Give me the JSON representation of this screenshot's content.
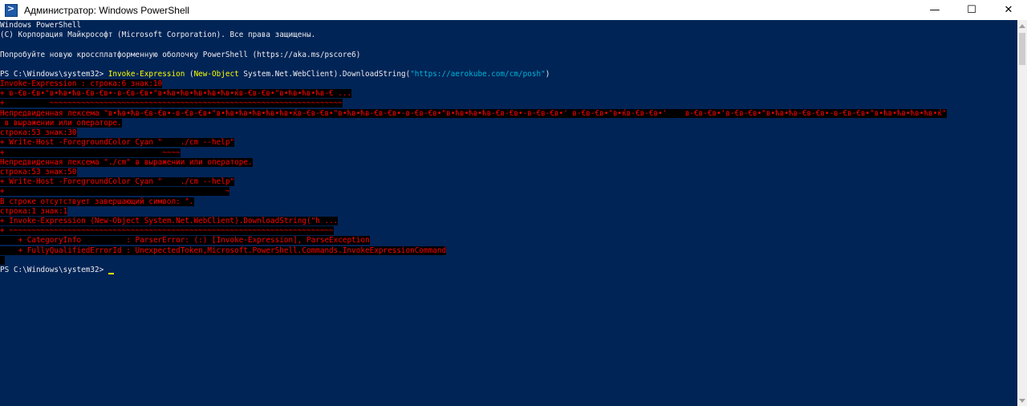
{
  "window": {
    "title": "Администратор: Windows PowerShell",
    "controls": {
      "minimize": "—",
      "maximize": "☐",
      "close": "✕"
    }
  },
  "console": {
    "header": [
      "Windows PowerShell",
      "(C) Корпорация Майкрософт (Microsoft Corporation). Все права защищены.",
      "",
      "Попробуйте новую кроссплатформенную оболочку PowerShell (https://aka.ms/pscore6)"
    ],
    "command": {
      "prompt": "PS C:\\Windows\\system32> ",
      "cmdlet": "Invoke-Expression",
      "space1": " ",
      "paren_open": "(",
      "new_object": "New-Object",
      "type": " System.Net.WebClient).DownloadString(",
      "url": "\"https://aerokube.com/cm/posh\"",
      "close": ")"
    },
    "errors": [
      "Invoke-Expression : строка:6 знак:10",
      "+ в-€в-€в•\"в•ћв•ћв-€в-€в•-в-€в-€в•\"в•ћв•ћв•ћв•ћв•ћв•ќв-€в-€в•\"в•ћв•ћв•ћв-€ ...",
      "+          ~~~~~~~~~~~~~~~~~~~~~~~~~~~~~~~~~~~~~~~~~~~~~~~~~~~~~~~~~~~~~~~~~",
      "Непредвиденная лексема \"в•ћв•ћв-€в-€в•-в-€в-€в•\"в•ћв•ћв•ћв•ћв•ћв•ќв-€в-€в•\"в•ћв•ћв-€в-€в•-в-€в-€в•\"в•ћв•ћв•ћв-€в-€в•-в-€в-€в•' в-€в-€в•\"в•ќв-€в-€в•'    в-€в-€в•'в-€в-€в•\"в•ћв•ћв-€в-€в•-в-€в-€в•\"в•ћв•ћв•ћв•ћв•ќ\"",
      " в выражении или операторе.",
      "строка:53 знак:30",
      "+ Write-Host -ForegroundColor Cyan \"    ./cm --help\"",
      "+                                   ~~~~",
      "Непредвиденная лексема \"./cm\" в выражении или операторе.",
      "строка:53 знак:50",
      "+ Write-Host -ForegroundColor Cyan \"    ./cm --help\"",
      "+                                                 ~",
      "В строке отсутствует завершающий символ: \".",
      "строка:1 знак:1",
      "+ Invoke-Expression (New-Object System.Net.WebClient).DownloadString(\"h ...",
      "+ ~~~~~~~~~~~~~~~~~~~~~~~~~~~~~~~~~~~~~~~~~~~~~~~~~~~~~~~~~~~~~~~~~~~~~~~~",
      "    + CategoryInfo          : ParserError: (:) [Invoke-Expression], ParseException",
      "    + FullyQualifiedErrorId : UnexpectedToken,Microsoft.PowerShell.Commands.InvokeExpressionCommand",
      " "
    ],
    "final_prompt": "PS C:\\Windows\\system32> "
  },
  "colors": {
    "background": "#012456",
    "error_fg": "#ff0000",
    "error_bg": "#000000",
    "command": "#ffff00",
    "string": "#00b4d8"
  }
}
